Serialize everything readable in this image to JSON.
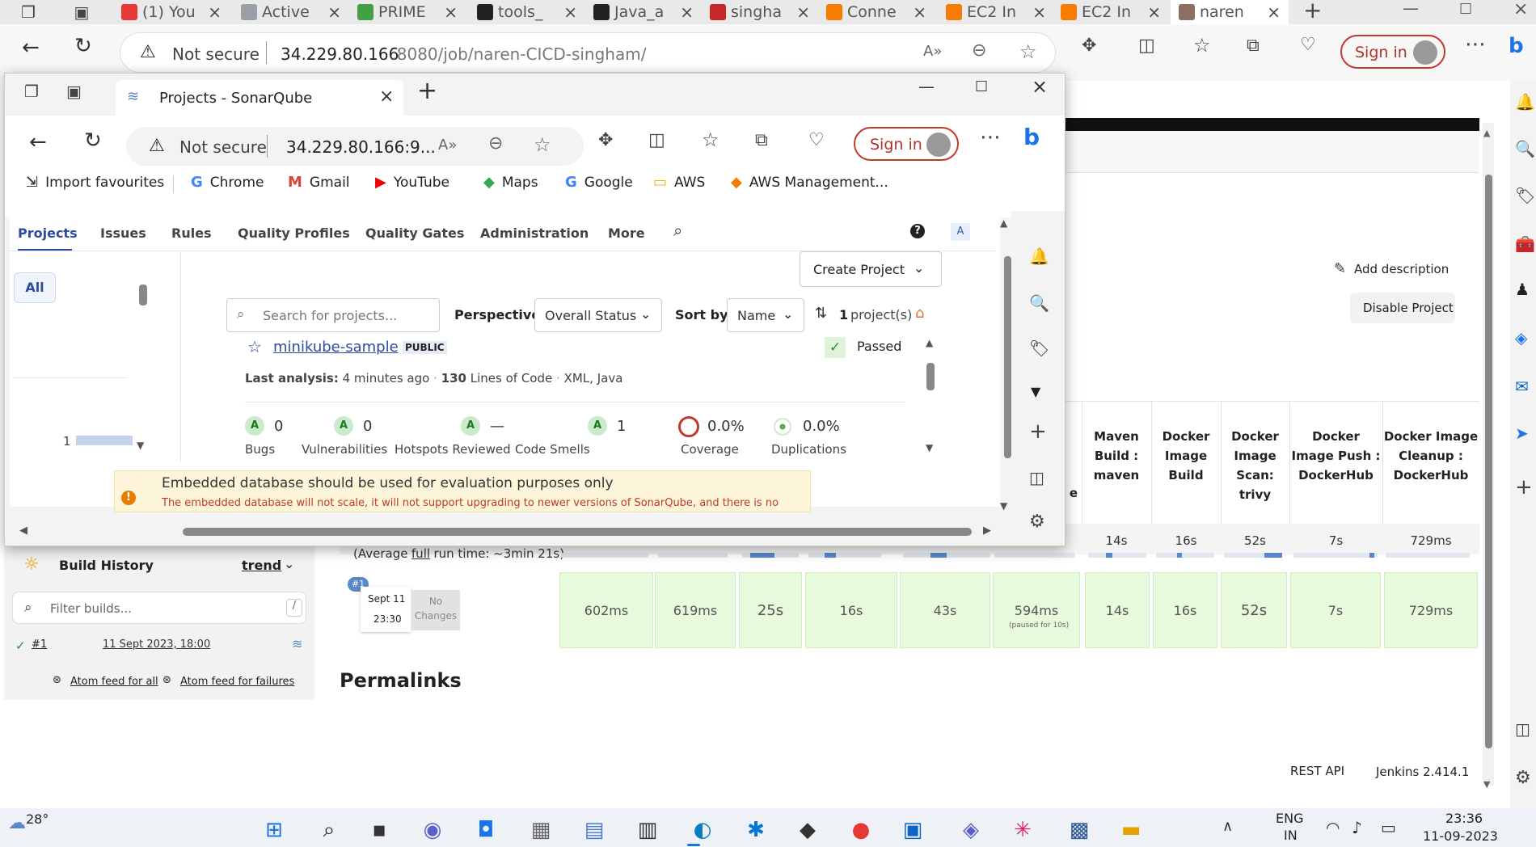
{
  "outer_tabs": [
    {
      "label": "(1) You",
      "color": "#e53935",
      "close": "×"
    },
    {
      "label": "Active",
      "color": "#9aa0a6",
      "close": "×"
    },
    {
      "label": "PRIME",
      "color": "#43a047",
      "close": "×"
    },
    {
      "label": "tools_",
      "color": "#222222",
      "close": "×"
    },
    {
      "label": "Java_a",
      "color": "#222222",
      "close": "×"
    },
    {
      "label": "singha",
      "color": "#c62828",
      "close": "×"
    },
    {
      "label": "Conne",
      "color": "#f57c00",
      "close": "×"
    },
    {
      "label": "EC2 In",
      "color": "#f57c00",
      "close": "×"
    },
    {
      "label": "EC2 In",
      "color": "#f57c00",
      "close": "×"
    },
    {
      "label": "naren",
      "color": "#8d6e63",
      "close": "×"
    }
  ],
  "outer_addr": {
    "security": "Not secure",
    "url_host": "34.229.80.166",
    "url_rest": ":8080/job/naren-CICD-singham/",
    "sign_in": "Sign in"
  },
  "popup": {
    "tab_title": "Projects - SonarQube",
    "security": "Not secure",
    "url": "34.229.80.166:9...",
    "sign_in": "Sign in",
    "bookmarks": [
      "Import favourites",
      "Chrome",
      "Gmail",
      "YouTube",
      "Maps",
      "Google",
      "AWS",
      "AWS Management..."
    ],
    "nav": [
      "Projects",
      "Issues",
      "Rules",
      "Quality Profiles",
      "Quality Gates",
      "Administration",
      "More"
    ],
    "avatar_letter": "A",
    "filter_all": "All",
    "filter_count": "1",
    "create_project": "Create Project",
    "search_placeholder": "Search for projects...",
    "perspective_label": "Perspective",
    "perspective_value": "Overall Status",
    "sort_label": "Sort by",
    "sort_value": "Name",
    "project_count": "1",
    "project_count_suffix": "project(s)",
    "project_name": "minikube-sample",
    "project_visibility": "PUBLIC",
    "gate_status": "Passed",
    "last_analysis_label": "Last analysis:",
    "last_analysis_value": "4 minutes ago",
    "loc_value": "130",
    "loc_label": "Lines of Code",
    "languages": "XML, Java",
    "metrics": [
      {
        "rating": "A",
        "value": "0",
        "label": "Bugs"
      },
      {
        "rating": "A",
        "value": "0",
        "label": "Vulnerabilities"
      },
      {
        "rating": "A",
        "value": "—",
        "label": "Hotspots Reviewed"
      },
      {
        "rating": "A",
        "value": "1",
        "label": "Code Smells"
      },
      {
        "rating": "",
        "value": "0.0%",
        "label": "Coverage"
      },
      {
        "rating": "",
        "value": "0.0%",
        "label": "Duplications"
      }
    ],
    "warning_title": "Embedded database should be used for evaluation purposes only",
    "warning_body": "The embedded database will not scale, it will not support upgrading to newer versions of SonarQube, and there is no support for migrating your data out of it into a different database engine."
  },
  "jenkins": {
    "add_description": "Add description",
    "disable_project": "Disable Project",
    "stage_headers": [
      "e",
      "Maven Build : maven",
      "Docker Image Build",
      "Docker Image Scan: trivy",
      "Docker Image Push : DockerHub",
      "Docker Image Cleanup : DockerHub"
    ],
    "avg_times": [
      "14s",
      "16s",
      "52s",
      "7s",
      "729ms"
    ],
    "avg_run": "(Average",
    "avg_full": "full",
    "avg_rest": "run time: ~3min 21s)",
    "build_badge": "#1",
    "build_date": "Sept 11",
    "build_time": "23:30",
    "no_changes": "No Changes",
    "build_cells": [
      "602ms",
      "619ms",
      "25s",
      "16s",
      "43s",
      "594ms",
      "14s",
      "16s",
      "52s",
      "7s",
      "729ms"
    ],
    "paused_note": "(paused for 10s)",
    "build_history": "Build History",
    "trend": "trend",
    "filter_placeholder": "Filter builds...",
    "filter_shortcut": "/",
    "build_link": "#1",
    "build_link_date": "11 Sept 2023, 18:00",
    "atom_all": "Atom feed for all",
    "atom_fail": "Atom feed for failures",
    "permalinks": "Permalinks",
    "rest_api": "REST API",
    "version": "Jenkins 2.414.1"
  },
  "taskbar": {
    "temp": "28°",
    "lang_top": "ENG",
    "lang_bottom": "IN",
    "time": "23:36",
    "date": "11-09-2023"
  }
}
